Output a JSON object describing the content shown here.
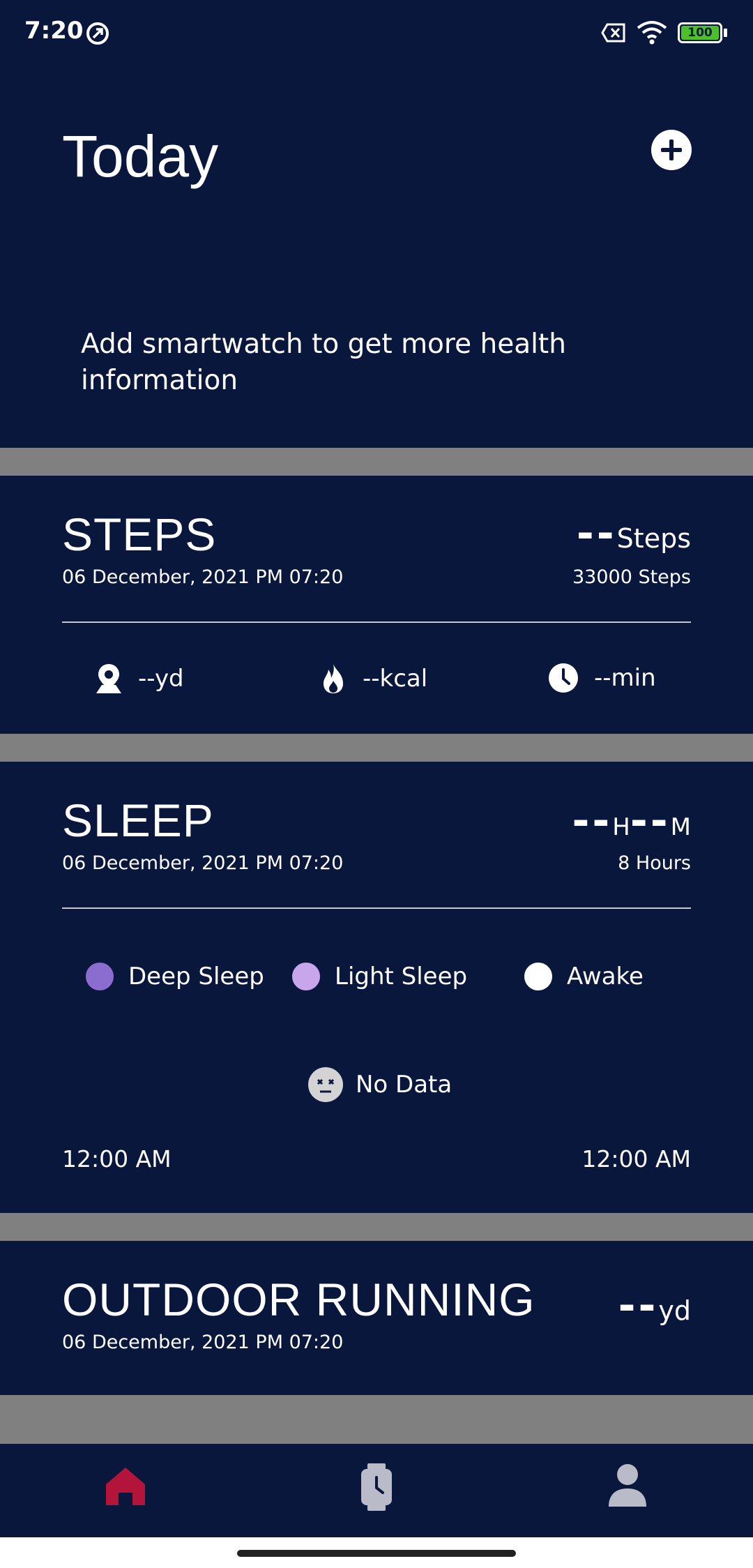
{
  "status_bar": {
    "time": "7:20",
    "battery": "100",
    "icons": [
      "sync-icon",
      "sim-blocked-icon",
      "wifi-icon",
      "battery-icon"
    ]
  },
  "header": {
    "title": "Today",
    "add_icon": "plus-circle-icon",
    "promo_text": "Add smartwatch to get more health information"
  },
  "steps": {
    "title": "STEPS",
    "date": "06 December, 2021 PM 07:20",
    "value": "--",
    "unit": "Steps",
    "goal": "33000 Steps",
    "metrics": [
      {
        "icon": "location-pin-icon",
        "label": "--yd"
      },
      {
        "icon": "flame-icon",
        "label": "--kcal"
      },
      {
        "icon": "clock-icon",
        "label": "--min"
      }
    ]
  },
  "sleep": {
    "title": "SLEEP",
    "date": "06 December, 2021 PM 07:20",
    "hours_value": "--",
    "hours_unit": "H",
    "minutes_value": "--",
    "minutes_unit": "M",
    "goal": "8 Hours",
    "legend": [
      {
        "label": "Deep Sleep",
        "color": "#8b6ccf"
      },
      {
        "label": "Light Sleep",
        "color": "#c8a6ec"
      },
      {
        "label": "Awake",
        "color": "#ffffff"
      }
    ],
    "no_data": "No Data",
    "start_time": "12:00 AM",
    "end_time": "12:00 AM"
  },
  "outdoor_running": {
    "title": "OUTDOOR RUNNING",
    "date": "06 December, 2021 PM 07:20",
    "value": "--",
    "unit": "yd"
  },
  "nav": {
    "items": [
      {
        "icon": "home-icon",
        "active": true
      },
      {
        "icon": "watch-icon",
        "active": false
      },
      {
        "icon": "user-icon",
        "active": false
      }
    ],
    "active_color": "#b3143a",
    "inactive_color": "#b9bcc8"
  }
}
